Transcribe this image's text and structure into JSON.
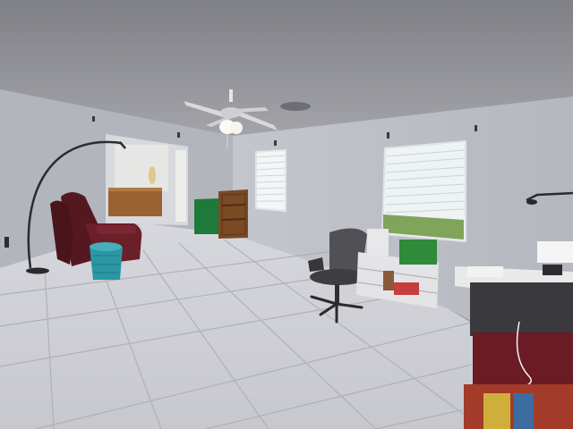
{
  "scene": {
    "kind": "photo",
    "subject": "empty-room-interior",
    "colors": {
      "ceiling": "#8e8f93",
      "wall": "#b9bcc3",
      "wall_shadow": "#a4a7ae",
      "floor": "#cfd0d6",
      "grout": "#a9aab2",
      "recliner": "#5a1a22",
      "ottoman": "#2a9aa5",
      "cabinet_green": "#1f7a3a",
      "bookcase": "#7a4a25",
      "chair": "#4a4a4e",
      "window_light": "#eef3f4",
      "lawn": "#6d9b4b"
    }
  }
}
